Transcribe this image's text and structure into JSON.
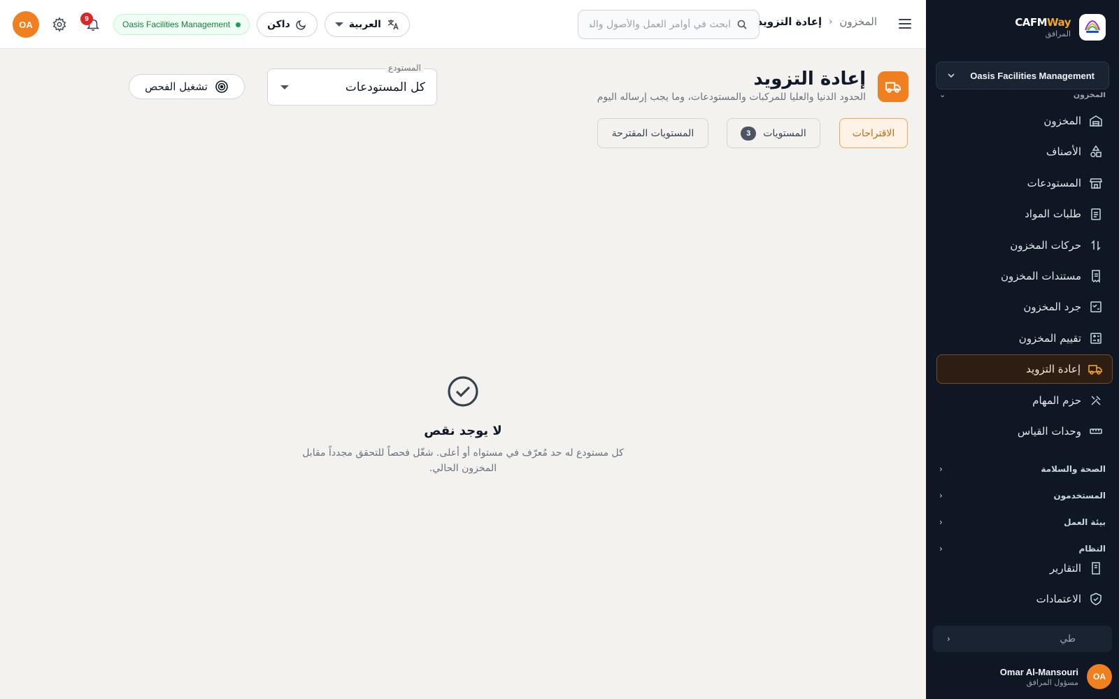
{
  "brand": {
    "name_a": "CAFM",
    "name_b": "Way",
    "subtitle": "المرافق"
  },
  "sidebar": {
    "org_selector": "Oasis Facilities Management",
    "group_header": "المخزون",
    "items": [
      {
        "label": "المخزون",
        "icon": "warehouse-icon"
      },
      {
        "label": "الأصناف",
        "icon": "shapes-icon"
      },
      {
        "label": "المستودعات",
        "icon": "store-icon"
      },
      {
        "label": "طلبات المواد",
        "icon": "clipboard-list-icon"
      },
      {
        "label": "حركات المخزون",
        "icon": "arrows-updown-icon"
      },
      {
        "label": "مستندات المخزون",
        "icon": "receipt-icon"
      },
      {
        "label": "جرد المخزون",
        "icon": "checklist-icon"
      },
      {
        "label": "تقييم المخزون",
        "icon": "calculator-icon"
      },
      {
        "label": "إعادة التزويد",
        "icon": "truck-icon",
        "active": true
      },
      {
        "label": "حزم المهام",
        "icon": "tools-icon"
      },
      {
        "label": "وحدات القياس",
        "icon": "ruler-icon"
      }
    ],
    "groups": [
      {
        "label": "الصحة والسلامة"
      },
      {
        "label": "المستخدمون"
      },
      {
        "label": "بيئة العمل"
      },
      {
        "label": "النظام"
      }
    ],
    "bottom_items": [
      {
        "label": "التقارير",
        "icon": "report-icon"
      },
      {
        "label": "الاعتمادات",
        "icon": "shield-check-icon"
      }
    ],
    "collapse_label": "طي",
    "user": {
      "initials": "OA",
      "name": "Omar Al-Mansouri",
      "role": "مسؤول المرافق"
    }
  },
  "topbar": {
    "breadcrumb": {
      "parent": "المخزون",
      "current": "إعادة التزويد"
    },
    "search_placeholder": "ابحث في أوامر العمل والأصول والمستودعات...",
    "language": "العربية",
    "theme": "داكن",
    "org": "Oasis Facilities Management",
    "notifications": "9",
    "avatar": "OA"
  },
  "page": {
    "title": "إعادة التزويد",
    "subtitle": "الحدود الدنيا والعليا للمركبات والمستودعات، وما يجب إرساله اليوم",
    "warehouse_filter": {
      "label": "المستودع",
      "value": "كل المستودعات"
    },
    "run_check": "تشغيل الفحص",
    "tabs": [
      {
        "label": "الاقتراحات",
        "active": true
      },
      {
        "label": "المستويات",
        "count": "3"
      },
      {
        "label": "المستويات المقترحة"
      }
    ],
    "empty": {
      "title": "لا يوجد نقص",
      "desc": "كل مستودع له حد مُعرّف في مستواه أو أعلى. شغّل فحصاً للتحقق مجدداً مقابل المخزون الحالي."
    }
  },
  "colors": {
    "accent": "#f07f1f",
    "sidebar_bg": "#0f1724",
    "active_bg": "#2e1d12",
    "success": "#16a34a"
  }
}
